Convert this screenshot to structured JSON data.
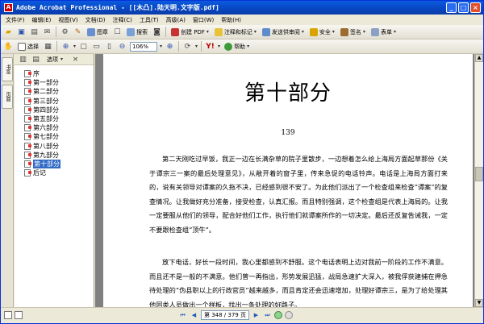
{
  "window": {
    "title": "Adobe Acrobat Professional - [[木凸].陆天明.文字版.pdf]",
    "app_icon_glyph": "A"
  },
  "menu": [
    "文件(F)",
    "编辑(E)",
    "视图(V)",
    "文档(D)",
    "注释(C)",
    "工具(T)",
    "高级(A)",
    "窗口(W)",
    "帮助(H)"
  ],
  "toolbar1": {
    "image_label": "图章",
    "search_label": "搜索",
    "create_pdf_label": "创建 PDF",
    "comment_label": "注释和标记",
    "send_review_label": "发送供审阅",
    "security_label": "安全",
    "sign_label": "签名",
    "form_label": "表单"
  },
  "toolbar2": {
    "select_label": "选择",
    "zoom_value": "106%",
    "help_label": "帮助"
  },
  "side_tabs": [
    "书签",
    "页面"
  ],
  "bookmarks": {
    "options_label": "选项",
    "items": [
      {
        "label": "序"
      },
      {
        "label": "第一部分"
      },
      {
        "label": "第二部分"
      },
      {
        "label": "第三部分"
      },
      {
        "label": "第四部分"
      },
      {
        "label": "第五部分"
      },
      {
        "label": "第六部分"
      },
      {
        "label": "第七部分"
      },
      {
        "label": "第八部分"
      },
      {
        "label": "第九部分"
      },
      {
        "label": "第十部分"
      },
      {
        "label": "后记"
      }
    ],
    "selected_index": 10
  },
  "document": {
    "part_title": "第十部分",
    "page_number": "139",
    "paragraph1": "第二天刚吃过早饭，我正一边在长满杂草的院子里散步，一边想着怎么给上海局方面起草那份《关于谭宗三一案的最后处理意见》，从敞开着的窗子里，传来急促的电话铃声。电话是上海局方面打来的，说有关领导对谭案的久拖不决，已经感到很不安了。为此他们派出了一个检查组来检查“谭案”的复查情况。让我做好充分准备，接受检查，认真汇报。而且特别强调，这个检查组是代表上海局的。让我一定要服从他们的领导，配合好他们工作，执行他们就谭案所作的一切决定。最后还反复告诫我，一定不要跟检查组“顶牛”。",
    "paragraph2": "放下电话，好长一段时间，我心里都感到不舒服。这个电话表明上边对我前一阶段的工作不满意。而且还不是一般的不满意。他们曾一再指出，形势发展迅猛，战局急速扩大深入，被我俘获建捕在押急待处理的“伪县职以上的行政官员”越来越多，而且肯定还会迅速增加，处理好谭宗三，是为了给处理其他同类人员做出一个样板，找出一条处理的好路子。"
  },
  "status": {
    "page_indicator": "第 348 / 379 页"
  },
  "colors": {
    "titlebar": "#0846c0",
    "selection": "#316ac5",
    "doc_background": "#808080"
  }
}
